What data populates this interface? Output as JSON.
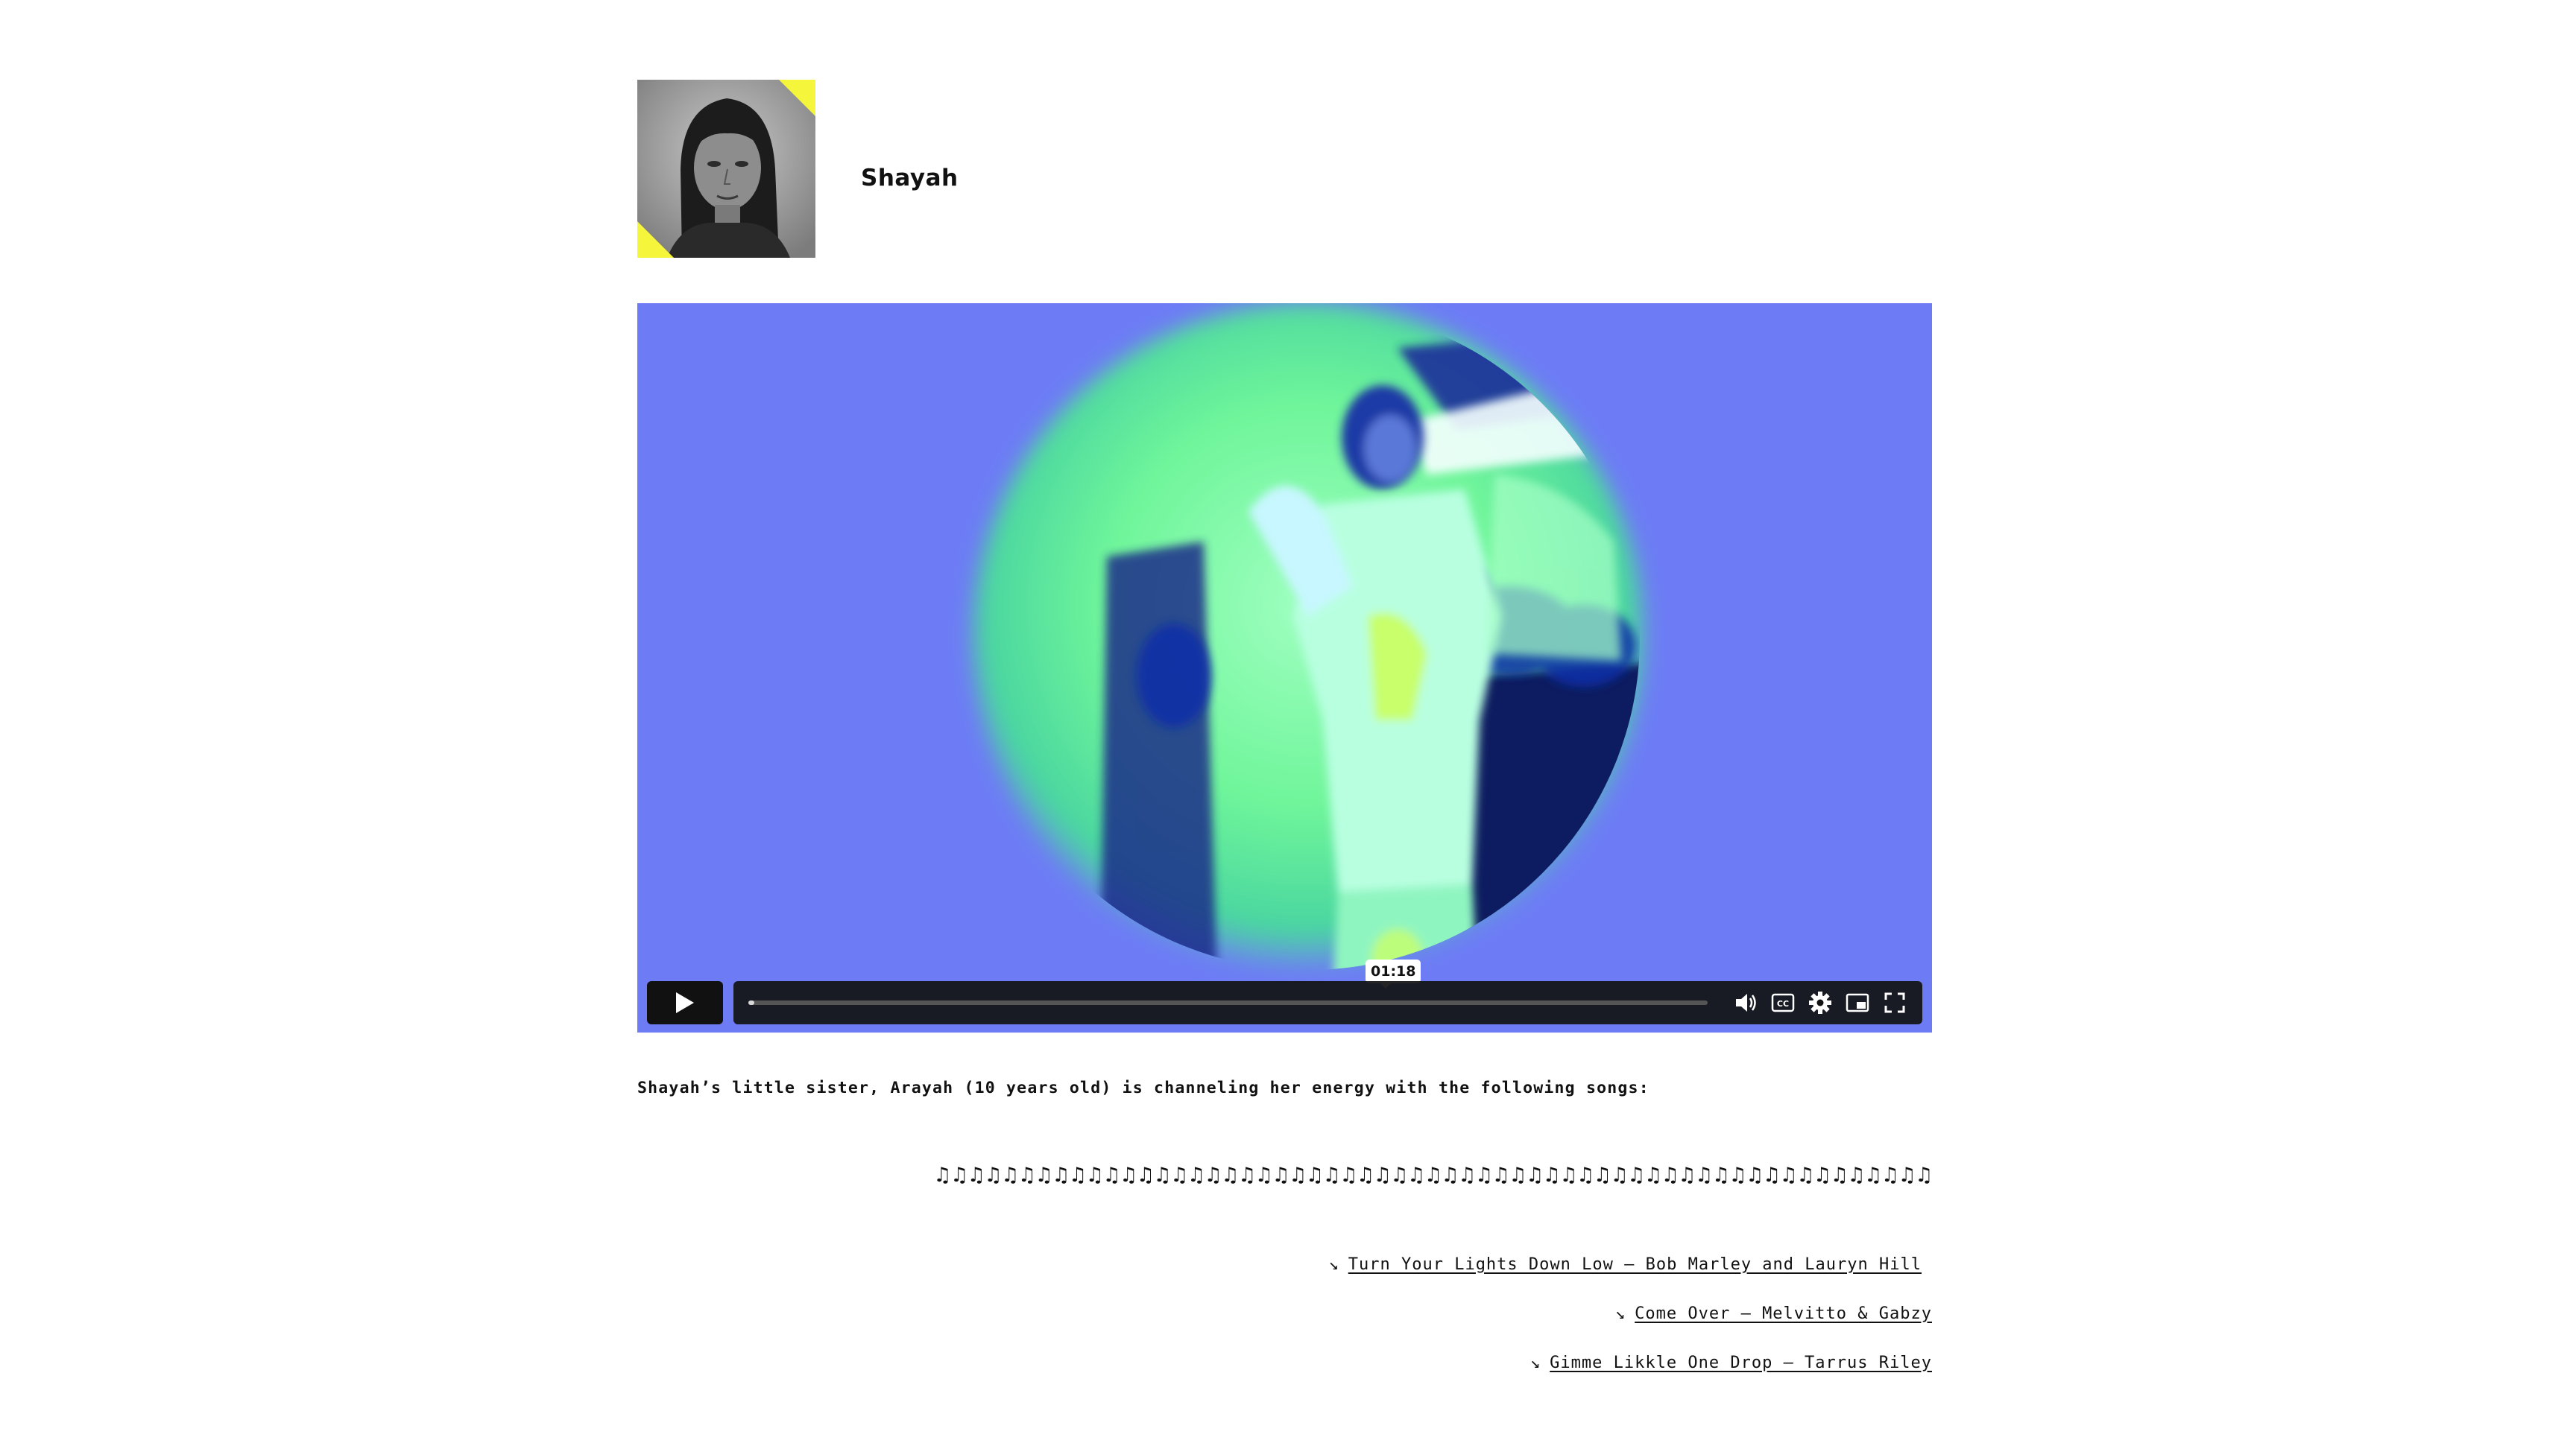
{
  "profile": {
    "name": "Shayah"
  },
  "video": {
    "time_tooltip": "01:18",
    "progress_fraction": 0.006,
    "controls": [
      "play-icon",
      "volume-icon",
      "captions-icon",
      "settings-icon",
      "pip-icon",
      "fullscreen-icon"
    ]
  },
  "description": "Shayah’s little sister, Arayah (10 years old) is channeling her energy with the following songs:",
  "music_notes": "♫♫♫♫♫♫♫♫♫♫♫♫♫♫♫♫♫♫♫♫♫♫♫♫♫♫♫♫♫♫♫♫♫♫♫♫♫♫♫♫♫♫♫♫♫♫♫♫♫♫♫♫♫♫♫♫♫♫♫",
  "songs": [
    {
      "arrow": "↘",
      "label": "Turn Your Lights Down Low – Bob Marley and Lauryn Hill"
    },
    {
      "arrow": "↘",
      "label": "Come Over – Melvitto & Gabzy"
    },
    {
      "arrow": "↘",
      "label": "Gimme Likkle One Drop – Tarrus Riley"
    }
  ],
  "colors": {
    "video_background": "#6d7cf5",
    "accent_yellow": "#f5f53b",
    "glow_green": "#7ff58c"
  }
}
